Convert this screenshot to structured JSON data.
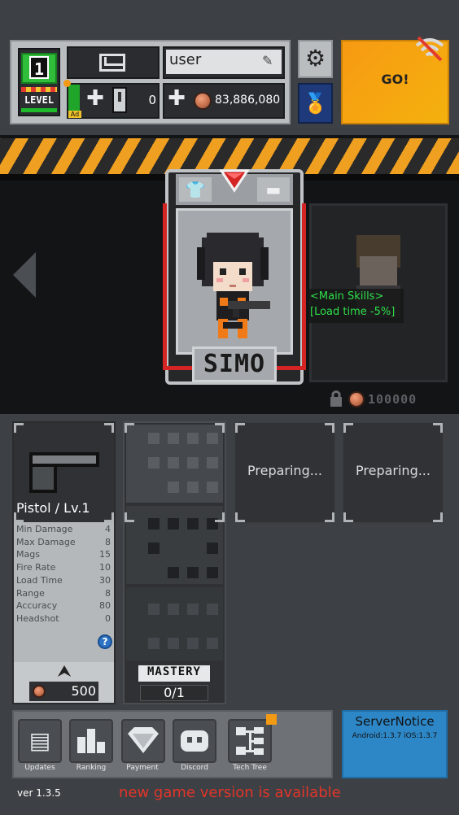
{
  "player": {
    "level": "1",
    "level_label": "LEVEL",
    "name": "user",
    "energy": "0",
    "ad_label": "Ad",
    "coins": "83,886,080"
  },
  "go": {
    "label": "GO!"
  },
  "character": {
    "name": "SIMO",
    "skill_title": "<Main Skills>",
    "skill_desc": "[Load time -5%]",
    "locked_price": "100000"
  },
  "weapon": {
    "title": "Pistol / Lv.1",
    "stats": [
      {
        "label": "Min Damage",
        "value": "4"
      },
      {
        "label": "Max Damage",
        "value": "8"
      },
      {
        "label": "Mags",
        "value": "15"
      },
      {
        "label": "Fire Rate",
        "value": "10"
      },
      {
        "label": "Load Time",
        "value": "30"
      },
      {
        "label": "Range",
        "value": "8"
      },
      {
        "label": "Accuracy",
        "value": "80"
      },
      {
        "label": "Headshot",
        "value": "0"
      }
    ],
    "help": "?",
    "upgrade_price": "500"
  },
  "mastery": {
    "label": "MASTERY",
    "count": "0/1"
  },
  "slots": [
    {
      "label": "Preparing..."
    },
    {
      "label": "Preparing..."
    }
  ],
  "bottom_nav": [
    {
      "label": "Updates",
      "icon": "news-icon"
    },
    {
      "label": "Ranking",
      "icon": "ranking-icon"
    },
    {
      "label": "Payment",
      "icon": "diamond-icon"
    },
    {
      "label": "Discord",
      "icon": "discord-icon"
    },
    {
      "label": "Tech Tree",
      "icon": "tech-tree-icon"
    }
  ],
  "server_notice": {
    "title": "ServerNotice",
    "versions": "Android:1.3.7 iOS:1.3.7"
  },
  "footer": {
    "version": "ver 1.3.5",
    "update_message": "new game version is available"
  },
  "colors": {
    "go": "#f79a13",
    "accent_red": "#d42424",
    "skill_green": "#2ee04a",
    "notice_blue": "#2d86c6",
    "warning_red": "#e2352a"
  }
}
